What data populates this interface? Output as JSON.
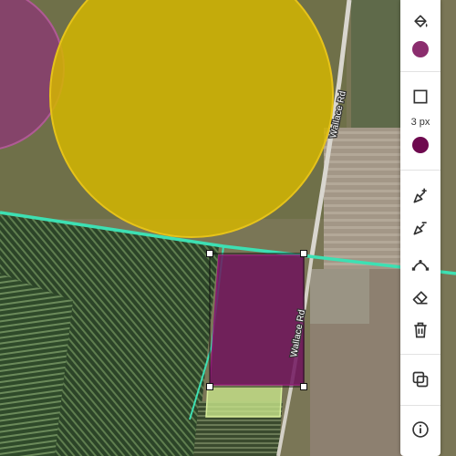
{
  "map": {
    "roads": [
      {
        "name": "Wallace Rd"
      },
      {
        "name": "Wallace Rd"
      }
    ],
    "shapes": [
      {
        "kind": "circle",
        "fill": "#d4b500",
        "stroke": "#e6c31a"
      },
      {
        "kind": "circle",
        "fill": "#8b3a73",
        "stroke": "#b05a95"
      },
      {
        "kind": "rectangle",
        "fill": "#6e0f5c",
        "stroke": "#8b1a73",
        "selected": true
      },
      {
        "kind": "rectangle",
        "fill": "#c7e38a",
        "stroke": "#d9ef9c"
      },
      {
        "kind": "boundary-line",
        "color": "#3de0b3"
      }
    ]
  },
  "toolbar": {
    "fill_color": "#8b2d6e",
    "stroke_width_label": "3 px",
    "stroke_color": "#6e0a4f",
    "tools": [
      {
        "name": "fill-tool",
        "icon": "paint-bucket-icon"
      },
      {
        "name": "stroke-tool",
        "icon": "square-outline-icon"
      },
      {
        "name": "add-vertex",
        "icon": "pen-plus-icon"
      },
      {
        "name": "remove-vertex",
        "icon": "pen-minus-icon"
      },
      {
        "name": "curve",
        "icon": "bezier-curve-icon"
      },
      {
        "name": "erase",
        "icon": "eraser-icon"
      },
      {
        "name": "delete",
        "icon": "trash-icon"
      },
      {
        "name": "duplicate",
        "icon": "copy-icon"
      },
      {
        "name": "info",
        "icon": "info-icon"
      }
    ]
  }
}
